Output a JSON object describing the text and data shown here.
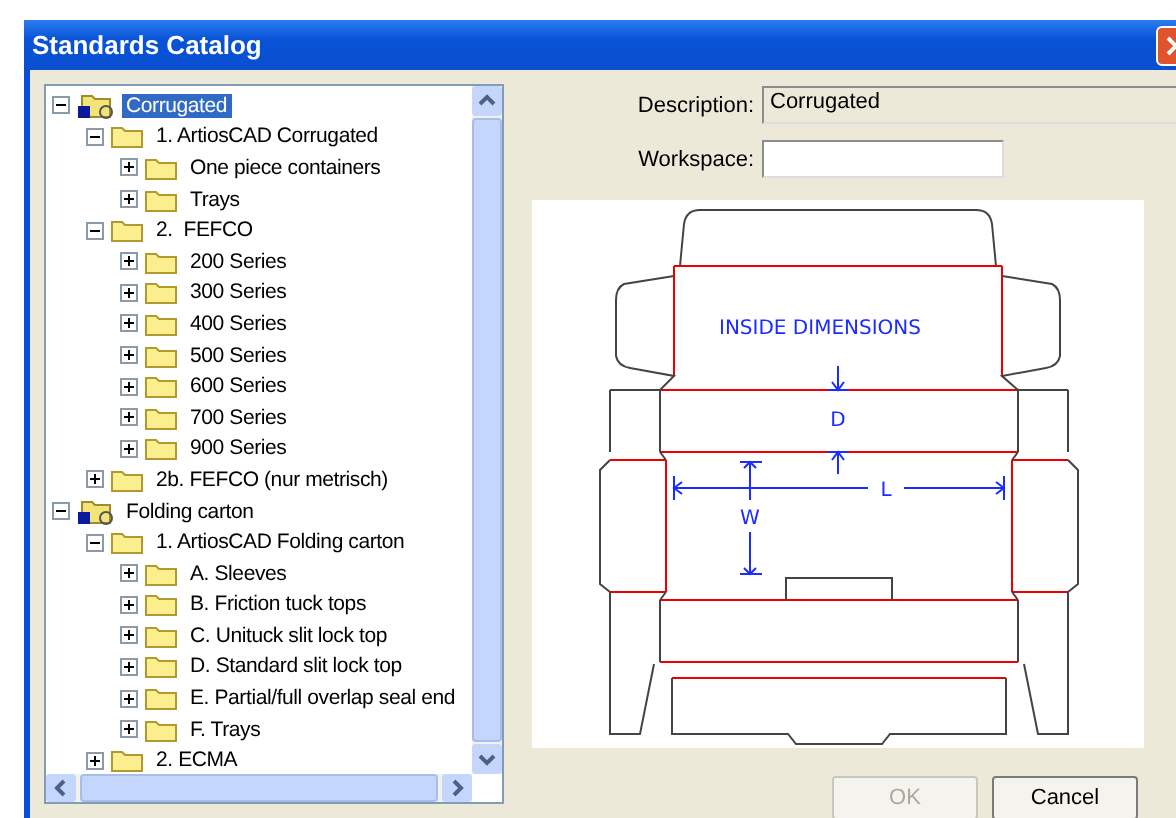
{
  "window": {
    "title": "Standards Catalog"
  },
  "tree": [
    {
      "label": "Corrugated",
      "kind": "catalog",
      "expanded": true,
      "selected": true,
      "children": [
        {
          "label": "1. ArtiosCAD Corrugated",
          "kind": "folder",
          "expanded": true,
          "selected": false,
          "children": [
            {
              "label": "One piece containers",
              "kind": "folder",
              "expanded": false,
              "selected": false
            },
            {
              "label": "Trays",
              "kind": "folder",
              "expanded": false,
              "selected": false
            }
          ]
        },
        {
          "label": "2.  FEFCO",
          "kind": "folder",
          "expanded": true,
          "selected": false,
          "children": [
            {
              "label": "200 Series",
              "kind": "folder",
              "expanded": false,
              "selected": false
            },
            {
              "label": "300 Series",
              "kind": "folder",
              "expanded": false,
              "selected": false
            },
            {
              "label": "400 Series",
              "kind": "folder",
              "expanded": false,
              "selected": false
            },
            {
              "label": "500 Series",
              "kind": "folder",
              "expanded": false,
              "selected": false
            },
            {
              "label": "600 Series",
              "kind": "folder",
              "expanded": false,
              "selected": false
            },
            {
              "label": "700 Series",
              "kind": "folder",
              "expanded": false,
              "selected": false
            },
            {
              "label": "900 Series",
              "kind": "folder",
              "expanded": false,
              "selected": false
            }
          ]
        },
        {
          "label": "2b. FEFCO (nur metrisch)",
          "kind": "folder",
          "expanded": false,
          "selected": false
        }
      ]
    },
    {
      "label": "Folding carton",
      "kind": "catalog",
      "expanded": true,
      "selected": false,
      "children": [
        {
          "label": "1. ArtiosCAD Folding carton",
          "kind": "folder",
          "expanded": true,
          "selected": false,
          "children": [
            {
              "label": "A. Sleeves",
              "kind": "folder",
              "expanded": false,
              "selected": false
            },
            {
              "label": "B. Friction tuck tops",
              "kind": "folder",
              "expanded": false,
              "selected": false
            },
            {
              "label": "C. Unituck slit lock top",
              "kind": "folder",
              "expanded": false,
              "selected": false
            },
            {
              "label": "D. Standard slit lock top",
              "kind": "folder",
              "expanded": false,
              "selected": false
            },
            {
              "label": "E. Partial/full overlap seal end",
              "kind": "folder",
              "expanded": false,
              "selected": false
            },
            {
              "label": "F. Trays",
              "kind": "folder",
              "expanded": false,
              "selected": false
            }
          ]
        },
        {
          "label": "2. ECMA",
          "kind": "folder",
          "expanded": false,
          "selected": false
        }
      ]
    }
  ],
  "description": {
    "label": "Description:",
    "value": "Corrugated"
  },
  "workspace": {
    "label": "Workspace:"
  },
  "preview": {
    "caption": "INSIDE DIMENSIONS",
    "dimension_labels": [
      "D",
      "L",
      "W"
    ]
  },
  "buttons": [
    {
      "label": "OK",
      "disabled": true
    },
    {
      "label": "Cancel",
      "disabled": false
    }
  ]
}
